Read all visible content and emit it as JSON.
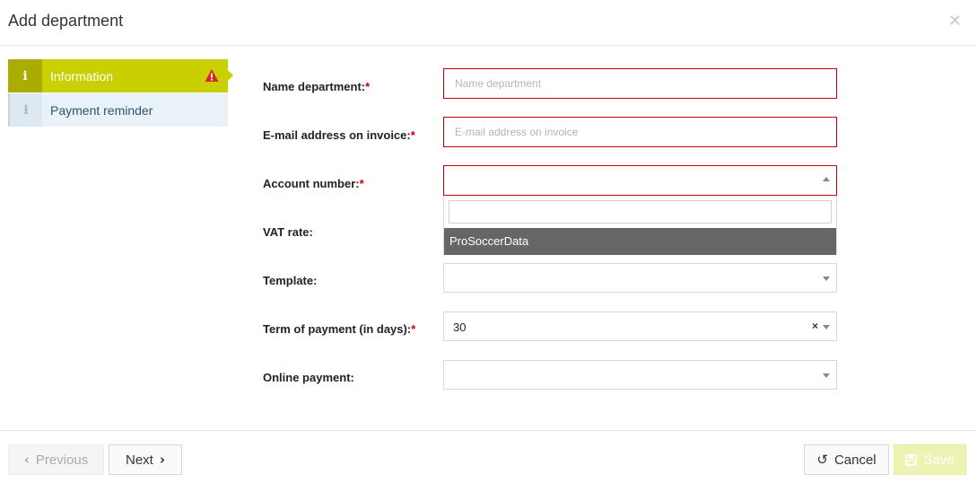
{
  "dialog": {
    "title": "Add department",
    "close_icon": "close-icon"
  },
  "nav": {
    "items": [
      {
        "label": "Information",
        "icon": "info-icon",
        "active": true,
        "warning_icon": "warning-icon"
      },
      {
        "label": "Payment reminder",
        "icon": "info-icon",
        "active": false
      }
    ]
  },
  "form": {
    "required_marker": "*",
    "name_department": {
      "label": "Name department:",
      "placeholder": "Name department",
      "value": ""
    },
    "email_invoice": {
      "label": "E-mail address on invoice:",
      "placeholder": "E-mail address on invoice",
      "value": ""
    },
    "account_number": {
      "label": "Account number:",
      "value": "",
      "open": true,
      "search_value": "",
      "options": [
        "ProSoccerData"
      ],
      "highlighted": "ProSoccerData"
    },
    "vat_rate": {
      "label": "VAT rate:"
    },
    "template": {
      "label": "Template:",
      "value": ""
    },
    "term_of_payment": {
      "label": "Term of payment (in days):",
      "value": "30"
    },
    "online_payment": {
      "label": "Online payment:",
      "value": ""
    }
  },
  "footer": {
    "previous_label": "Previous",
    "next_label": "Next",
    "cancel_label": "Cancel",
    "save_label": "Save"
  },
  "colors": {
    "accent": "#c9cf00",
    "error_border": "#c9000a",
    "option_highlight": "#666666",
    "nav_inactive_bg": "#e9f2f9"
  }
}
